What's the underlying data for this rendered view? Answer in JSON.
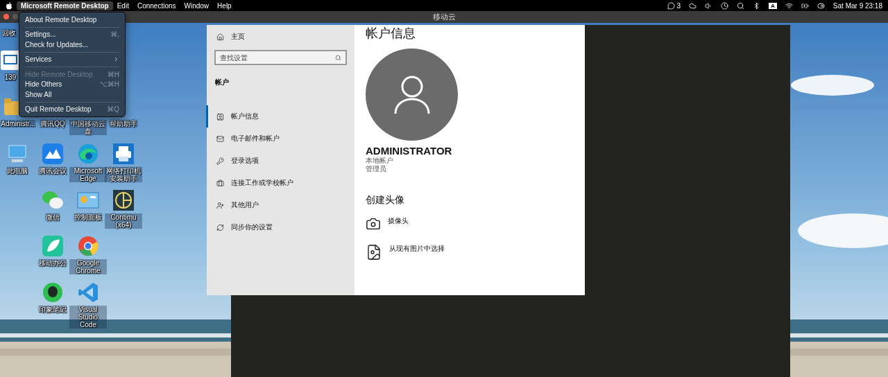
{
  "menu_bar": {
    "app_name": "Microsoft Remote Desktop",
    "menus": [
      "Edit",
      "Connections",
      "Window",
      "Help"
    ],
    "wechat_count": "3",
    "input_source": "A",
    "clock": "Sat Mar 9  23:18"
  },
  "app_menu": [
    {
      "kind": "item",
      "label": "About Remote Desktop",
      "disabled": false
    },
    {
      "kind": "separator"
    },
    {
      "kind": "item",
      "label": "Settings...",
      "shortcut": "⌘,",
      "disabled": false
    },
    {
      "kind": "item",
      "label": "Check for Updates...",
      "disabled": false
    },
    {
      "kind": "separator"
    },
    {
      "kind": "submenu",
      "label": "Services",
      "disabled": false
    },
    {
      "kind": "separator"
    },
    {
      "kind": "item",
      "label": "Hide Remote Desktop",
      "shortcut": "⌘H",
      "disabled": true
    },
    {
      "kind": "item",
      "label": "Hide Others",
      "shortcut": "⌥⌘H",
      "disabled": false
    },
    {
      "kind": "item",
      "label": "Show All",
      "disabled": false
    },
    {
      "kind": "separator"
    },
    {
      "kind": "item",
      "label": "Quit Remote Desktop",
      "shortcut": "⌘Q",
      "disabled": false
    }
  ],
  "window": {
    "title": "移动云"
  },
  "desktop_icons": [
    {
      "kind": "none",
      "label": "回收"
    },
    {
      "kind": "mail",
      "label": "139"
    },
    {
      "kind": "folder",
      "label": "Administr..."
    },
    {
      "kind": "none",
      "label": "腾讯QQ"
    },
    {
      "kind": "none",
      "label": "中国移动云盘"
    },
    {
      "kind": "none",
      "label": "帮助助手"
    },
    {
      "kind": "computer",
      "label": "此电脑"
    },
    {
      "kind": "meeting",
      "label": "腾讯会议"
    },
    {
      "kind": "edge",
      "label": "Microsoft Edge"
    },
    {
      "kind": "printer",
      "label": "网络打印机安装助手"
    },
    {
      "kind": "wechat",
      "label": "微信"
    },
    {
      "kind": "panel",
      "label": "控制面板"
    },
    {
      "kind": "cad",
      "label": "Contimu (x64)"
    },
    {
      "kind": "mobile",
      "label": "移动办公"
    },
    {
      "kind": "chrome",
      "label": "Google Chrome"
    },
    {
      "kind": "notes",
      "label": "印象笔记"
    },
    {
      "kind": "vscode",
      "label": "Visual Studio Code"
    }
  ],
  "settings": {
    "home": "主页",
    "search": {
      "placeholder": "查找设置"
    },
    "section": "帐户",
    "nav": [
      {
        "kind": "info",
        "label": "帐户信息",
        "selected": true
      },
      {
        "kind": "mail",
        "label": "电子邮件和帐户",
        "selected": false
      },
      {
        "kind": "key",
        "label": "登录选项",
        "selected": false
      },
      {
        "kind": "work",
        "label": "连接工作或学校帐户",
        "selected": false
      },
      {
        "kind": "user",
        "label": "其他用户",
        "selected": false
      },
      {
        "kind": "sync",
        "label": "同步你的设置",
        "selected": false
      }
    ],
    "title": "帐户信息",
    "user_name": "ADMINISTRATOR",
    "account_type": "本地帐户",
    "role": "管理员",
    "create_heading": "创建头像",
    "options": [
      {
        "kind": "camera",
        "label": "摄像头"
      },
      {
        "kind": "browse",
        "label": "从现有图片中选择"
      }
    ]
  }
}
